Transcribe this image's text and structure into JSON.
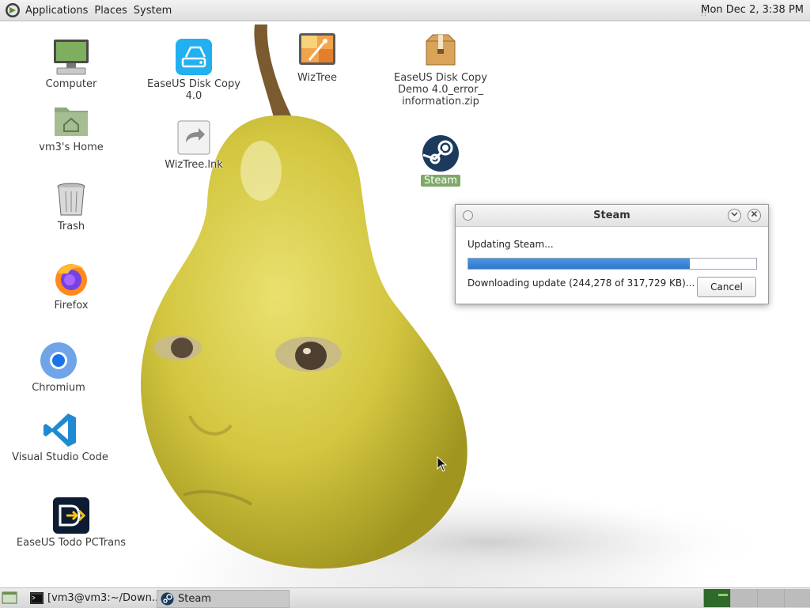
{
  "top_panel": {
    "menus": [
      "Applications",
      "Places",
      "System"
    ],
    "clock": "Mon Dec  2,  3:38 PM"
  },
  "desktop_icons": [
    {
      "label": "Computer",
      "icon": "computer-icon"
    },
    {
      "label": "vm3's Home",
      "icon": "home-folder-icon"
    },
    {
      "label": "Trash",
      "icon": "trash-icon"
    },
    {
      "label": "Firefox",
      "icon": "firefox-icon"
    },
    {
      "label": "Chromium",
      "icon": "chromium-icon"
    },
    {
      "label": "Visual Studio Code",
      "icon": "vscode-icon"
    },
    {
      "label": "EaseUS Todo PCTrans",
      "icon": "pctrans-icon"
    },
    {
      "label": "EaseUS Disk Copy 4.0",
      "icon": "easeus-disk-copy-icon"
    },
    {
      "label": "WizTree.lnk",
      "icon": "shortcut-icon"
    },
    {
      "label": "WizTree",
      "icon": "wiztree-icon"
    },
    {
      "label": "EaseUS Disk Copy\nDemo 4.0_error_\ninformation.zip",
      "icon": "zip-archive-icon"
    },
    {
      "label": "Steam",
      "icon": "steam-icon"
    }
  ],
  "dialog": {
    "title": "Steam",
    "status": "Updating Steam...",
    "progress": 0.7688,
    "detail": "Downloading update (244,278 of 317,729 KB)...",
    "cancel_label": "Cancel"
  },
  "taskbar": {
    "tasks": [
      "[vm3@vm3:~/Down...",
      "Steam"
    ],
    "workspaces": 4,
    "active_workspace": 1
  },
  "colors": {
    "progress_fill": "#2f78cf",
    "selection": "#7fa86a",
    "workspace_active": "#2f6a2a"
  }
}
